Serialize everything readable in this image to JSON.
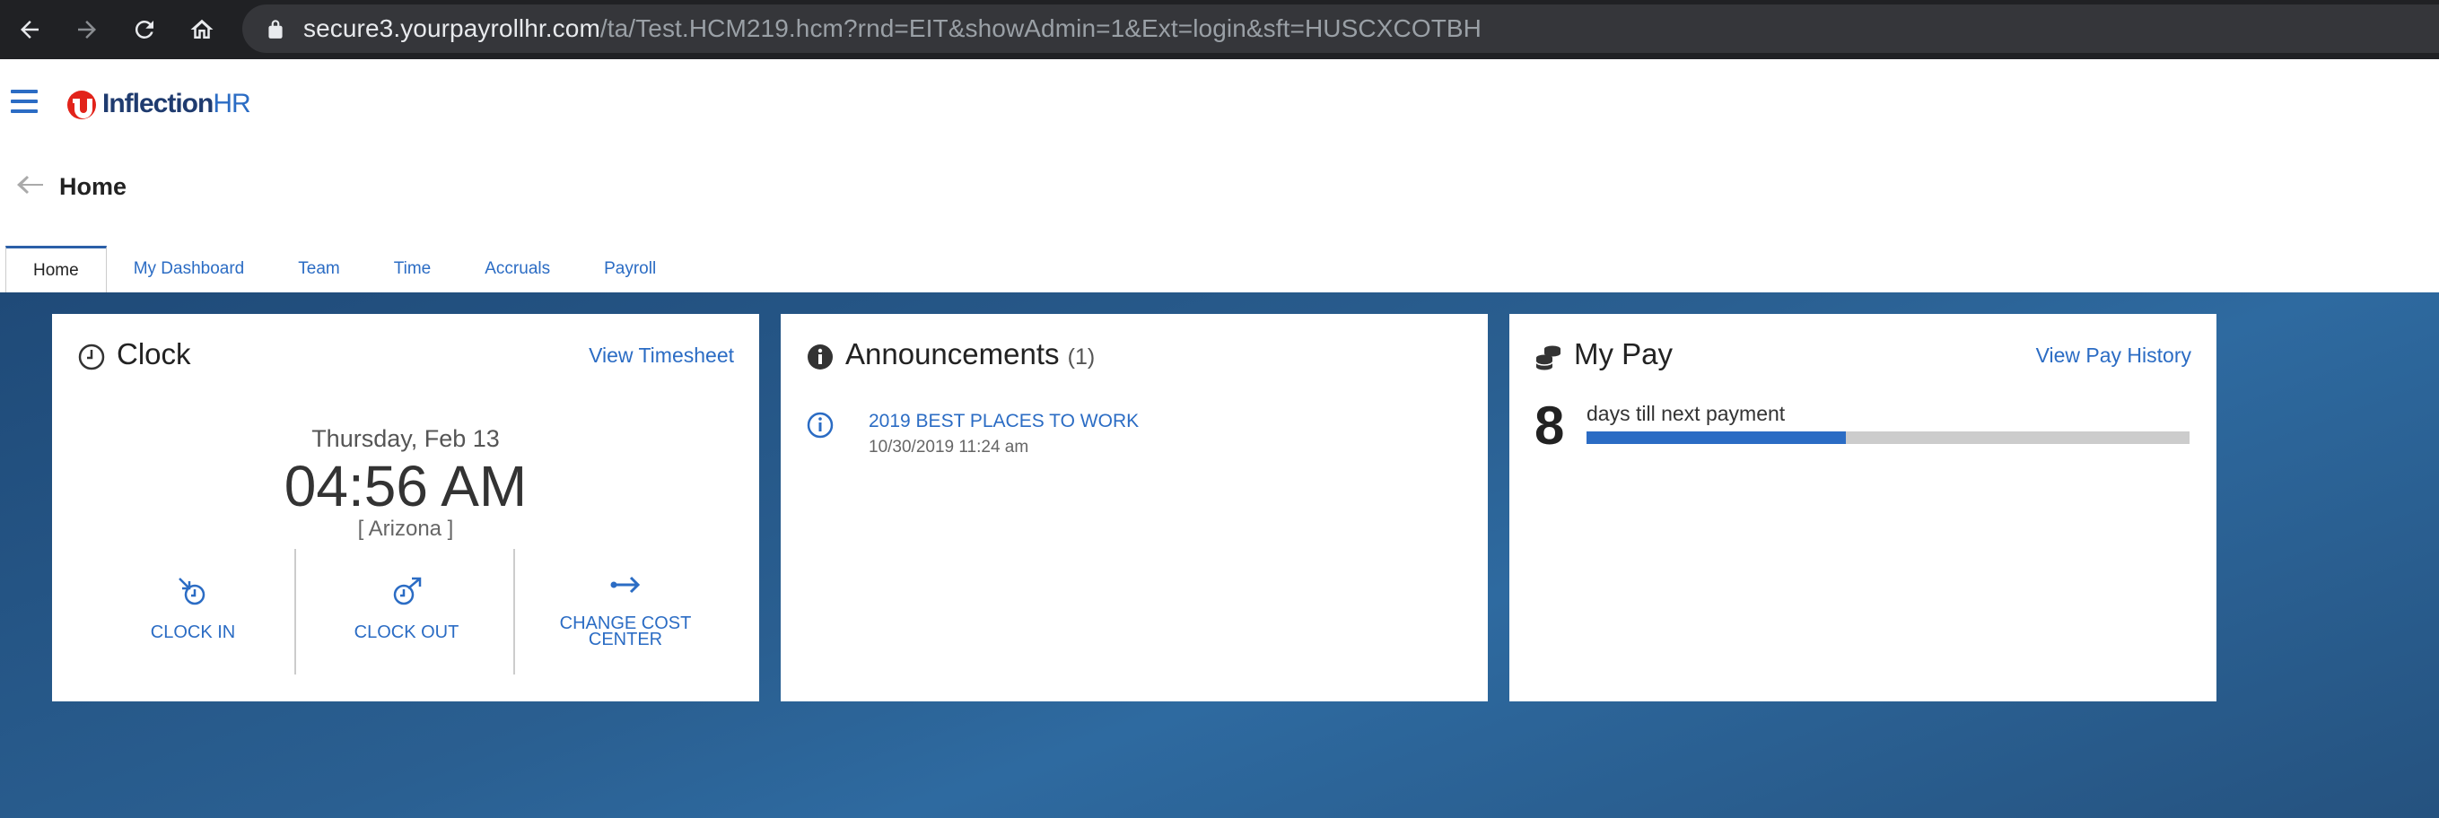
{
  "browser": {
    "url_host": "secure3.yourpayrollhr.com",
    "url_path": "/ta/Test.HCM219.hcm?rnd=EIT&showAdmin=1&Ext=login&sft=HUSCXCOTBH"
  },
  "app": {
    "logo_name": "Inflection",
    "logo_suffix": "HR"
  },
  "page": {
    "title": "Home"
  },
  "tabs": [
    {
      "label": "Home",
      "active": true
    },
    {
      "label": "My Dashboard",
      "active": false
    },
    {
      "label": "Team",
      "active": false
    },
    {
      "label": "Time",
      "active": false
    },
    {
      "label": "Accruals",
      "active": false
    },
    {
      "label": "Payroll",
      "active": false
    }
  ],
  "clock": {
    "title": "Clock",
    "link": "View Timesheet",
    "date": "Thursday, Feb 13",
    "time": "04:56 AM",
    "timezone": "[ Arizona ]",
    "actions": {
      "clock_in": "CLOCK IN",
      "clock_out": "CLOCK OUT",
      "change_cost_line1": "CHANGE COST",
      "change_cost_line2": "CENTER"
    }
  },
  "announcements": {
    "title": "Announcements",
    "count": "(1)",
    "items": [
      {
        "title": "2019 BEST PLACES TO WORK",
        "date": "10/30/2019 11:24 am"
      }
    ]
  },
  "pay": {
    "title": "My Pay",
    "link": "View Pay History",
    "days": "8",
    "days_label": "days till next payment",
    "progress_fraction": 0.43
  },
  "colors": {
    "accent": "#2b6cc4",
    "brand_red": "#e2231a",
    "brand_navy": "#1f3b6f"
  }
}
